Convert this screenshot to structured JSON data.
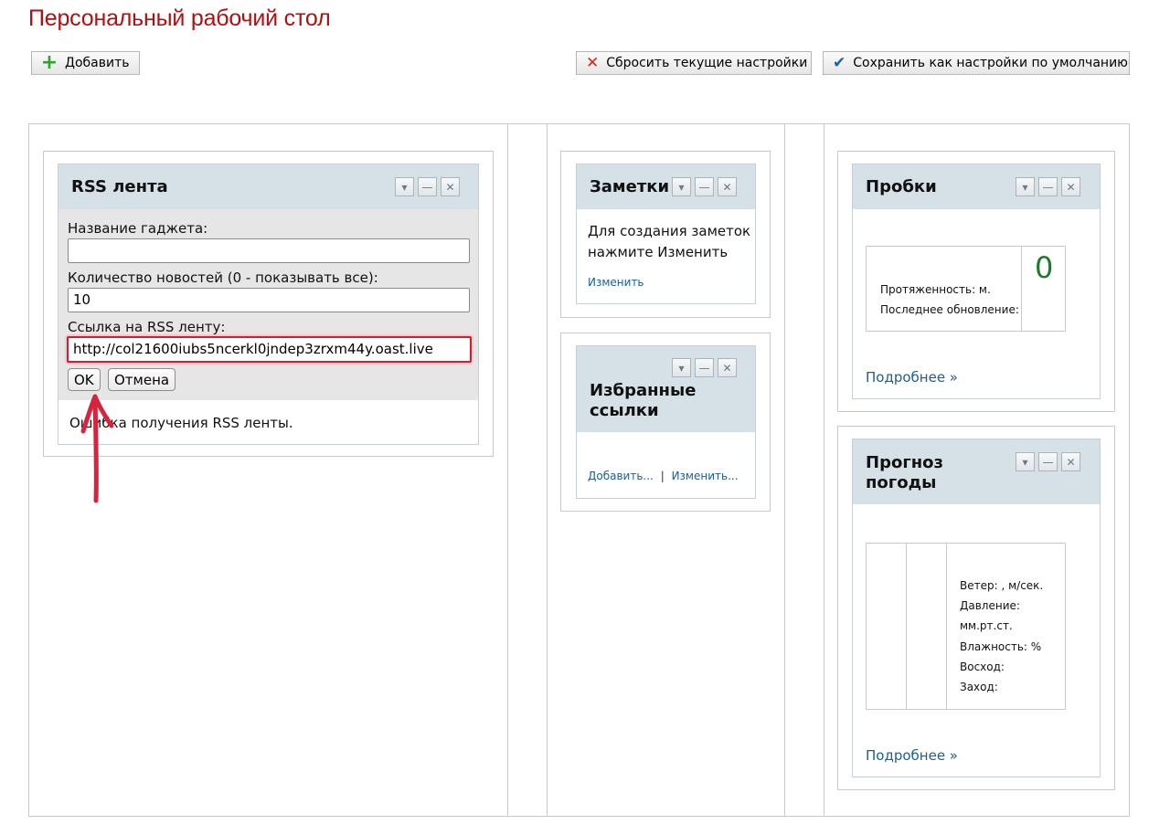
{
  "page": {
    "title": "Персональный рабочий стол"
  },
  "toolbar": {
    "add_label": "Добавить",
    "reset_label": "Сбросить текущие настройки",
    "save_label": "Сохранить как настройки по умолчанию"
  },
  "rss": {
    "title": "RSS лента",
    "name_label": "Название гаджета:",
    "name_value": "",
    "count_label": "Количество новостей (0 - показывать все):",
    "count_value": "10",
    "url_label": "Ссылка на RSS ленту:",
    "url_value": "http://col21600iubs5ncerkl0jndep3zrxm44y.oast.live",
    "ok_label": "OK",
    "cancel_label": "Отмена",
    "error_text": "Ошибка получения RSS ленты."
  },
  "notes": {
    "title": "Заметки",
    "body": "Для создания заметок нажмите Изменить",
    "edit_link": "Изменить"
  },
  "favorites": {
    "title": "Избранные ссылки",
    "add_link": "Добавить...",
    "separator": "|",
    "edit_link": "Изменить..."
  },
  "traffic": {
    "title": "Пробки",
    "length_label": "Протяженность: м.",
    "updated_label": "Последнее обновление:",
    "score": "0",
    "more_link": "Подробнее »"
  },
  "weather": {
    "title": "Прогноз погоды",
    "wind": "Ветер: , м/сек.",
    "pressure": "Давление:",
    "pressure_unit": "мм.рт.ст.",
    "humidity": "Влажность: %",
    "sunrise": "Восход:",
    "sunset": "Заход:",
    "more_link": "Подробнее »"
  },
  "icons": {
    "collapse": "chevron-down-icon",
    "minimize": "minus-icon",
    "close": "close-icon"
  },
  "colors": {
    "title_red": "#b01010",
    "header_bg": "#d5e0e7",
    "link_blue": "#1a5e9a",
    "score_green": "#1f7a2e",
    "focus_red": "#d11f2f",
    "arrow_red": "#d6243c"
  }
}
